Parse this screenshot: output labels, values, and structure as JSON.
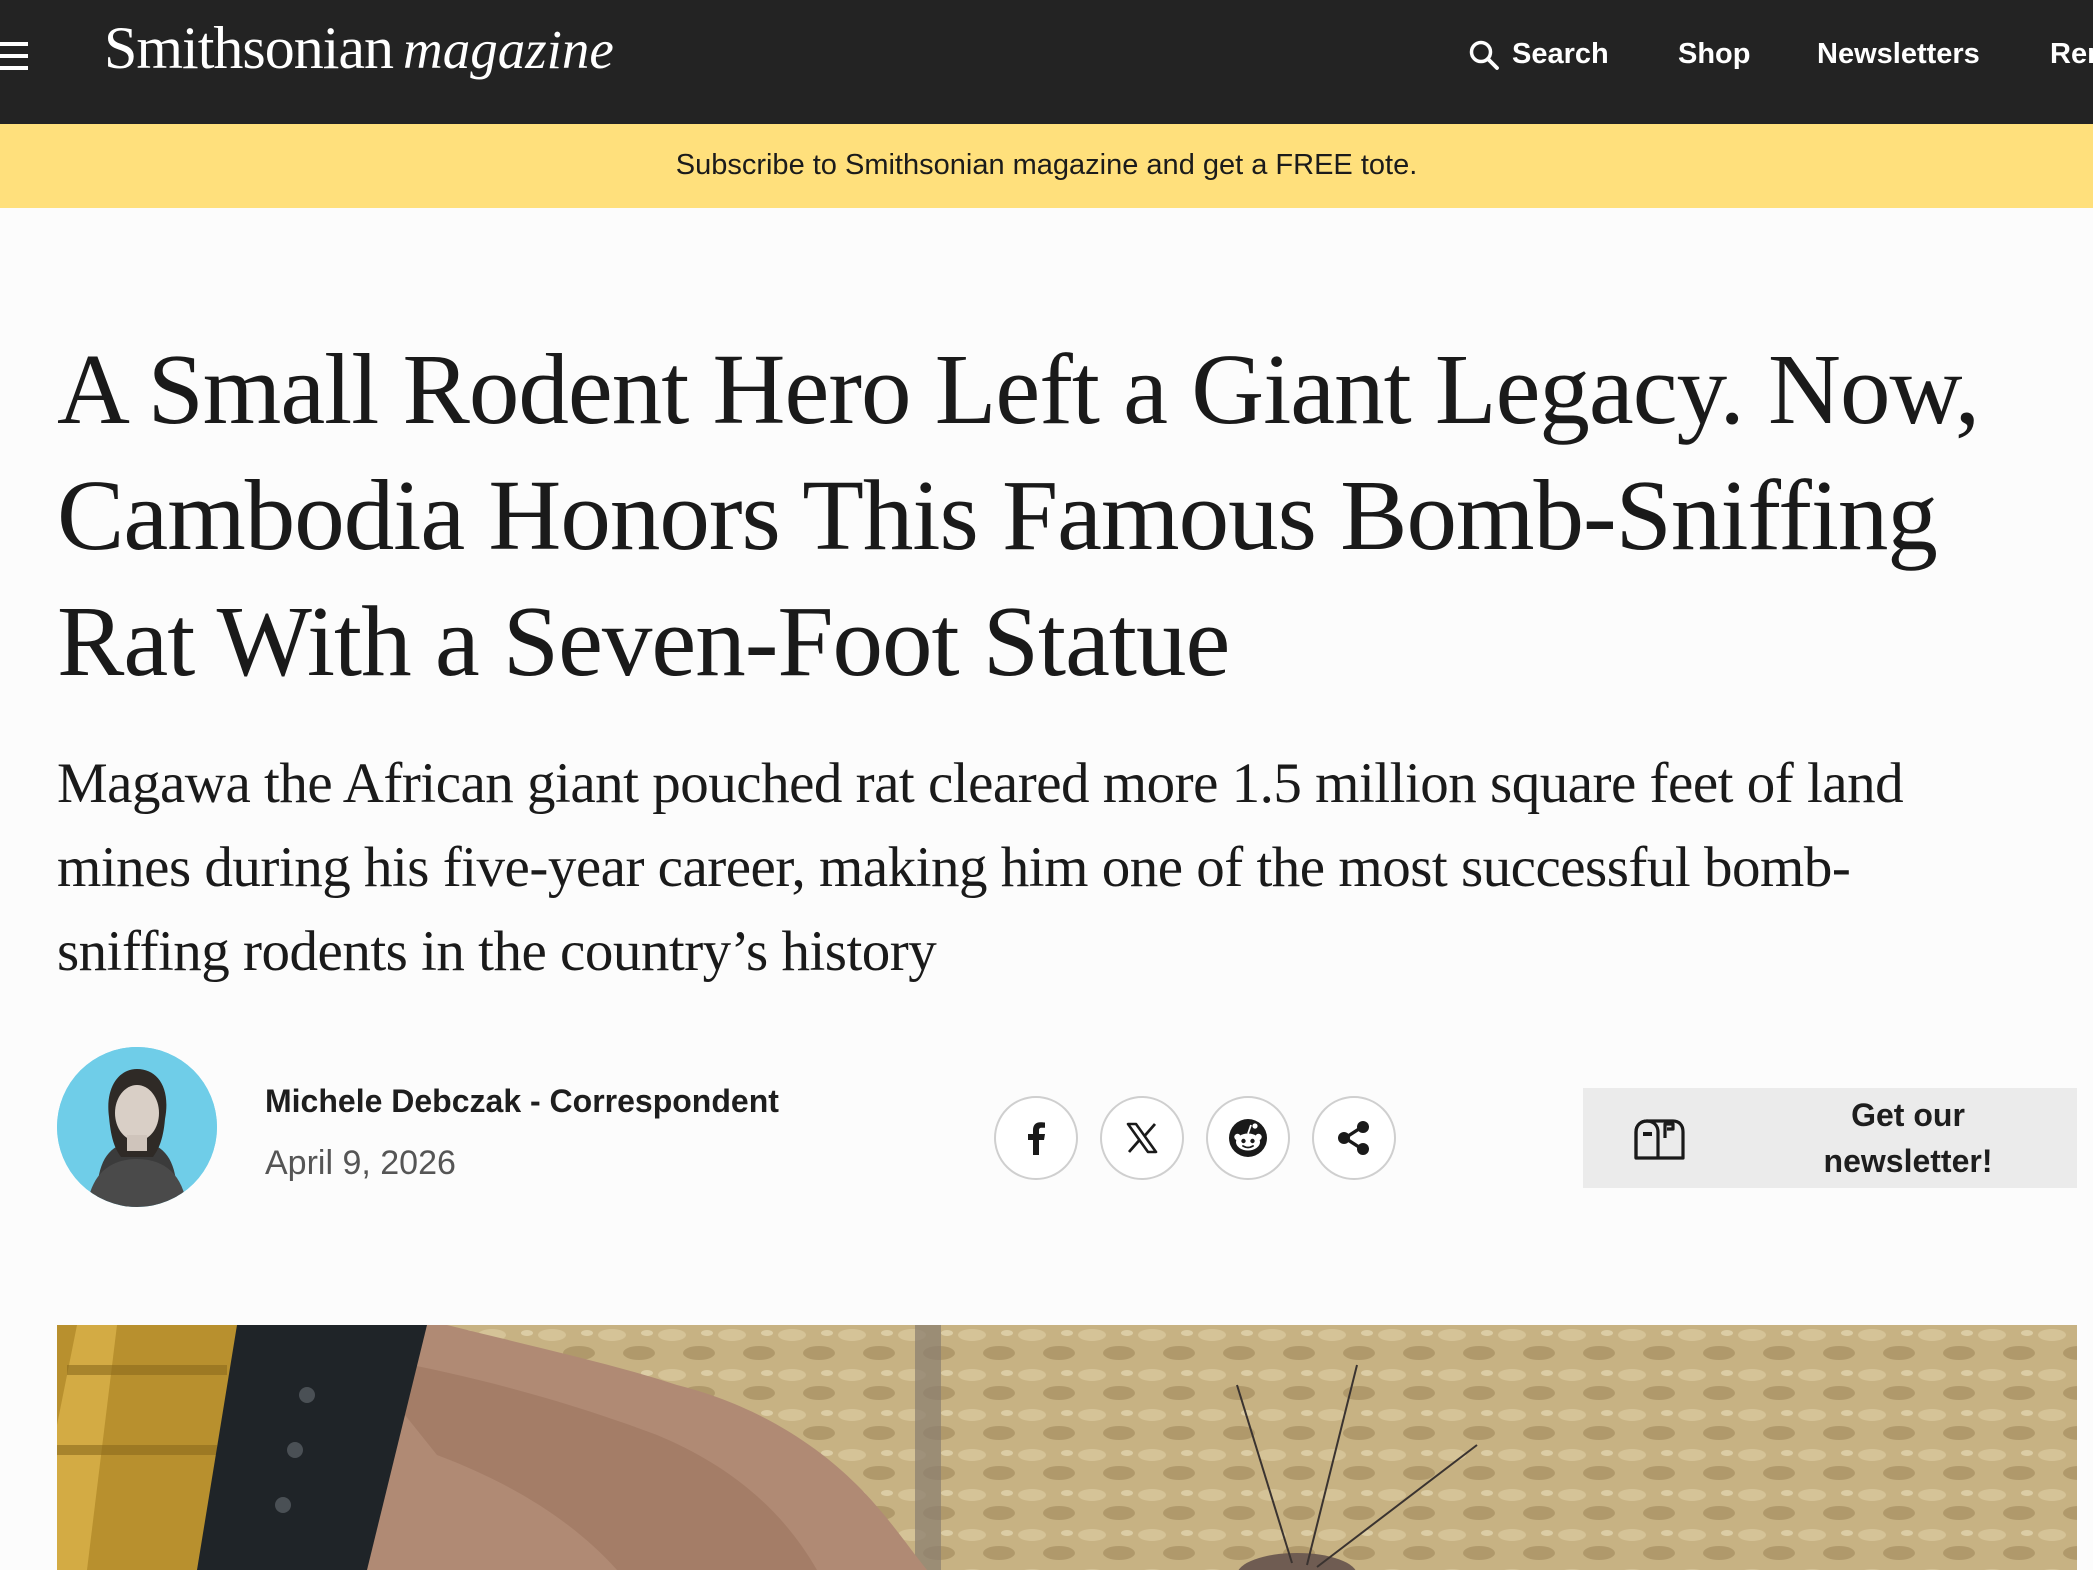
{
  "header": {
    "brand_main": "Smithsonian",
    "brand_sub": "magazine",
    "nav": {
      "search": "Search",
      "shop": "Shop",
      "newsletters": "Newsletters",
      "renew": "Ren"
    }
  },
  "promo": {
    "text": "Subscribe to Smithsonian magazine and get a FREE tote."
  },
  "article": {
    "headline_lines": [
      "A Small Rodent Hero Left a Giant Legacy. Now,",
      "Cambodia Honors This Famous Bomb-Sniffing",
      "Rat With a Seven-Foot Statue"
    ],
    "dek_lines": [
      "Magawa the African giant pouched rat cleared more 1.5 million square feet of land",
      "mines during his five-year career, making him one of the most successful bomb-",
      "sniffing rodents in the country’s history"
    ],
    "author": "Michele Debczak - Correspondent",
    "date": "April 9, 2026"
  },
  "share": {
    "icons": [
      "facebook-icon",
      "x-icon",
      "reddit-icon",
      "share-icon"
    ]
  },
  "newsletter_cta": {
    "line1": "Get our",
    "line2": "newsletter!",
    "icon": "mailbox-icon"
  },
  "colors": {
    "topbar": "#232323",
    "promo": "#ffe07c",
    "avatar_bg": "#6fcde8",
    "newsletter_bg": "#ebebeb"
  }
}
